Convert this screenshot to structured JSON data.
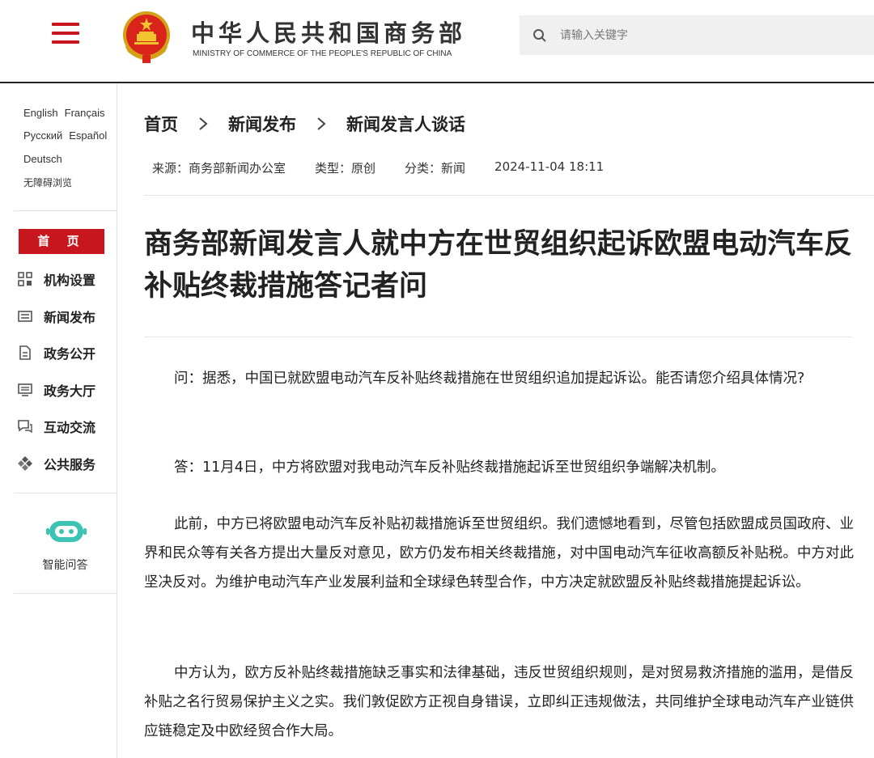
{
  "header": {
    "title": "中华人民共和国商务部",
    "subtitle": "MINISTRY OF COMMERCE OF THE PEOPLE'S REPUBLIC OF CHINA",
    "search_placeholder": "请输入关键字"
  },
  "sidebar": {
    "languages": [
      "English",
      "Français",
      "Русский",
      "Español",
      "Deutsch"
    ],
    "accessibility": "无障碍浏览",
    "home": "首 页",
    "nav": [
      {
        "label": "机构设置",
        "icon": "org-grid-icon"
      },
      {
        "label": "新闻发布",
        "icon": "newspaper-icon"
      },
      {
        "label": "政务公开",
        "icon": "document-icon"
      },
      {
        "label": "政务大厅",
        "icon": "monitor-icon"
      },
      {
        "label": "互动交流",
        "icon": "chat-icon"
      },
      {
        "label": "公共服务",
        "icon": "service-diamond-icon"
      }
    ],
    "assistant_label": "智能问答"
  },
  "breadcrumb": [
    "首页",
    "新闻发布",
    "新闻发言人谈话"
  ],
  "meta": {
    "source": "来源：商务部新闻办公室",
    "type": "类型：原创",
    "category": "分类：新闻",
    "datetime": "2024-11-04 18:11"
  },
  "article": {
    "title": "商务部新闻发言人就中方在世贸组织起诉欧盟电动汽车反补贴终裁措施答记者问",
    "paragraphs": [
      "问：据悉，中国已就欧盟电动汽车反补贴终裁措施在世贸组织追加提起诉讼。能否请您介绍具体情况?",
      "答：11月4日，中方将欧盟对我电动汽车反补贴终裁措施起诉至世贸组织争端解决机制。",
      "此前，中方已将欧盟电动汽车反补贴初裁措施诉至世贸组织。我们遗憾地看到，尽管包括欧盟成员国政府、业界和民众等有关各方提出大量反对意见，欧方仍发布相关终裁措施，对中国电动汽车征收高额反补贴税。中方对此坚决反对。为维护电动汽车产业发展利益和全球绿色转型合作，中方决定就欧盟反补贴终裁措施提起诉讼。",
      "中方认为，欧方反补贴终裁措施缺乏事实和法律基础，违反世贸组织规则，是对贸易救济措施的滥用，是借反补贴之名行贸易保护主义之实。我们敦促欧方正视自身错误，立即纠正违规做法，共同维护全球电动汽车产业链供应链稳定及中欧经贸合作大局。"
    ]
  },
  "colors": {
    "brand_red": "#c8161e",
    "assistant_teal": "#3cc3b3"
  }
}
